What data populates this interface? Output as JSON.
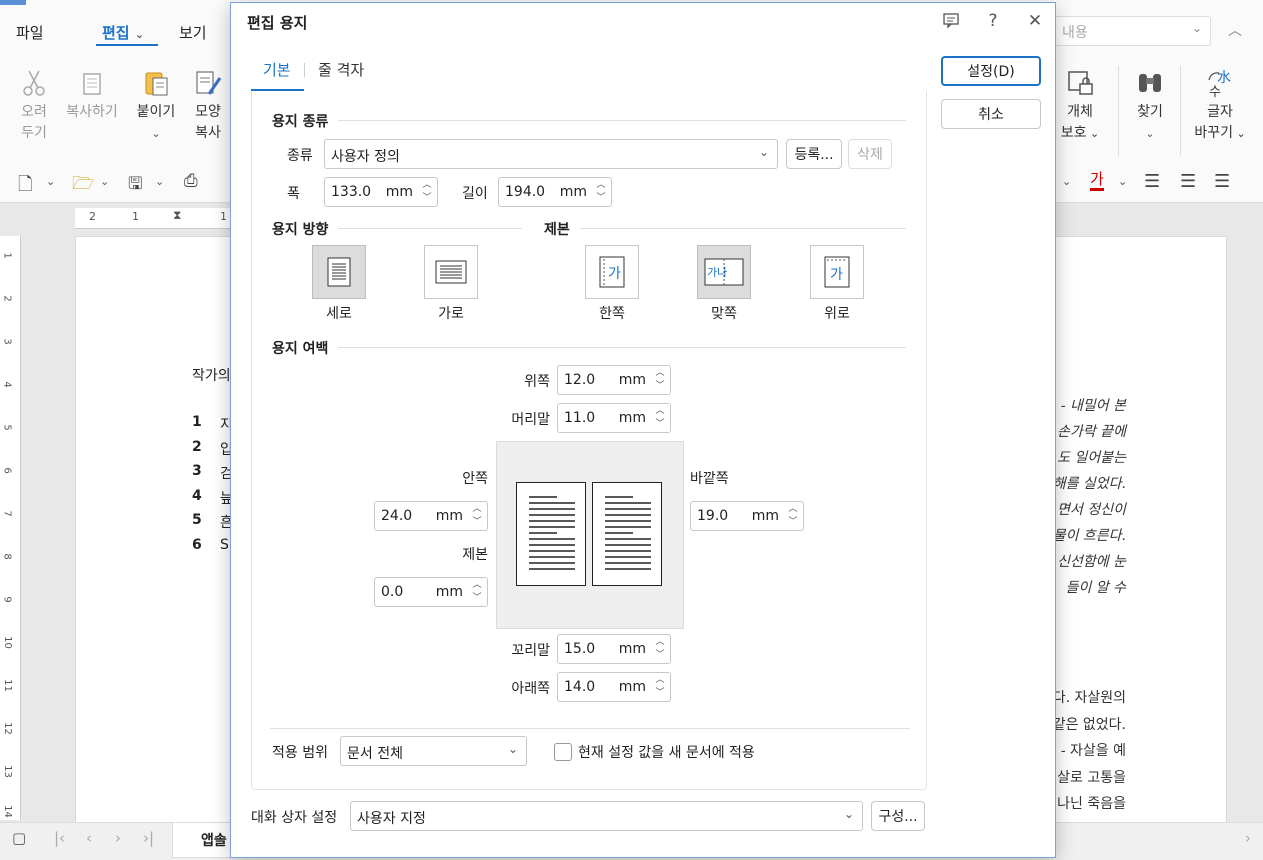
{
  "app": {
    "menu": [
      "파일",
      "편집",
      "보기"
    ],
    "active_menu": "편집",
    "ribbon_left": [
      {
        "label": "오려\n두기",
        "icon": "scissors-icon",
        "dim": true
      },
      {
        "label": "복사하기",
        "icon": "copy-icon",
        "dim": true
      },
      {
        "label": "붙이기",
        "icon": "paste-icon",
        "dim": false
      },
      {
        "label": "모양\n복사",
        "icon": "format-painter-icon",
        "dim": false
      }
    ],
    "ribbon_right": [
      {
        "label": "개체\n보호",
        "icon": "lock-object-icon"
      },
      {
        "label": "찾기",
        "icon": "binoculars-icon"
      },
      {
        "label": "글자\n바꾸기",
        "icon": "replace-icon"
      }
    ],
    "search_placeholder": "내용",
    "doc_heading": "작가의",
    "doc_list": [
      {
        "n": "1",
        "t": "지"
      },
      {
        "n": "2",
        "t": "입"
      },
      {
        "n": "3",
        "t": "검"
      },
      {
        "n": "4",
        "t": "늪"
      },
      {
        "n": "5",
        "t": "흔"
      },
      {
        "n": "6",
        "t": "S"
      }
    ],
    "doc_right_1": [
      "- 내밀어 본",
      "손가락 끝에",
      "도 일어붙는",
      "해를 실었다.",
      "면서 정신이",
      "물이 흐른다.",
      "신선함에 눈",
      "들이 알 수"
    ],
    "doc_right_2": [
      "다. 자살원의",
      "같은 없었다.",
      "- 자살을 예",
      "살로 고통을",
      "나닌 죽음을"
    ],
    "ruler_top": [
      "2",
      "1",
      "1"
    ],
    "ruler_left": [
      "1",
      "2",
      "3",
      "4",
      "5",
      "6",
      "7",
      "8",
      "9",
      "10",
      "11",
      "12",
      "13",
      "14"
    ],
    "sheet_tab": "앱솔"
  },
  "dialog": {
    "title": "편집 용지",
    "tabs": [
      "기본",
      "줄 격자"
    ],
    "active_tab": "기본",
    "ok_label": "설정(D)",
    "cancel_label": "취소",
    "paper_type": {
      "section": "용지 종류",
      "kind_label": "종류",
      "kind_value": "사용자 정의",
      "register_label": "등록...",
      "delete_label": "삭제",
      "width_label": "폭",
      "width_value": "133.0",
      "length_label": "길이",
      "length_value": "194.0",
      "unit": "mm"
    },
    "orientation": {
      "section": "용지 방향",
      "options": [
        "세로",
        "가로"
      ],
      "selected": "세로"
    },
    "binding": {
      "section": "제본",
      "options": [
        "한쪽",
        "맞쪽",
        "위로"
      ],
      "selected": "맞쪽",
      "glyph_single": "가",
      "glyph_facing": "가나"
    },
    "margins": {
      "section": "용지 여백",
      "top_label": "위쪽",
      "top_value": "12.0",
      "header_label": "머리말",
      "header_value": "11.0",
      "inner_label": "안쪽",
      "inner_value": "24.0",
      "gutter_label": "제본",
      "gutter_value": "0.0",
      "outer_label": "바깥쪽",
      "outer_value": "19.0",
      "footer_label": "꼬리말",
      "footer_value": "15.0",
      "bottom_label": "아래쪽",
      "bottom_value": "14.0",
      "unit": "mm"
    },
    "apply_scope_label": "적용 범위",
    "apply_scope_value": "문서 전체",
    "apply_new_doc_label": "현재 설정 값을 새 문서에 적용",
    "apply_new_doc_checked": false,
    "dialog_setting_label": "대화 상자 설정",
    "dialog_setting_value": "사용자 지정",
    "configure_label": "구성...",
    "accent_color": "#1a73c9"
  }
}
